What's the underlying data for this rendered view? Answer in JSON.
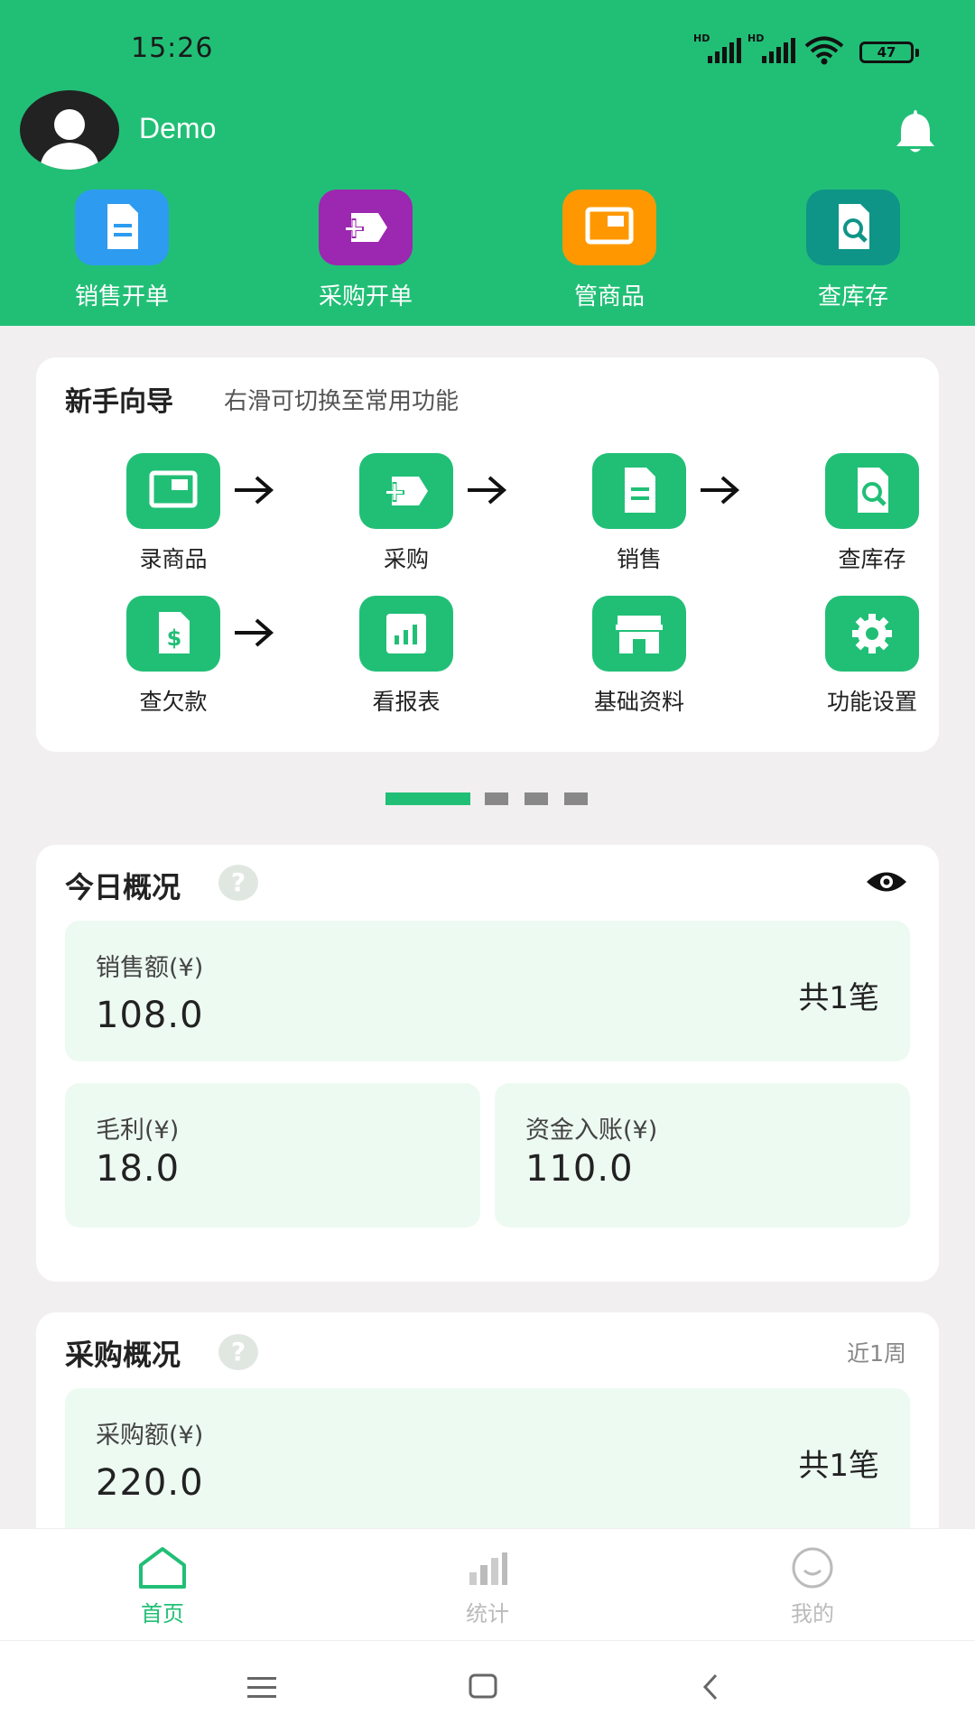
{
  "status": {
    "time": "15:26",
    "battery": "47",
    "sim1": "HD",
    "sim2": "HD"
  },
  "user": {
    "name": "Demo"
  },
  "quick_actions": [
    {
      "label": "销售开单",
      "icon": "document-icon",
      "color": "#2d9bf0"
    },
    {
      "label": "采购开单",
      "icon": "tag-plus-icon",
      "color": "#9c27b0"
    },
    {
      "label": "管商品",
      "icon": "product-card-icon",
      "color": "#ff9800"
    },
    {
      "label": "查库存",
      "icon": "search-document-icon",
      "color": "#0e9587"
    }
  ],
  "guide": {
    "title": "新手向导",
    "subtitle": "右滑可切换至常用功能",
    "items": [
      {
        "label": "录商品",
        "icon": "product-card-icon"
      },
      {
        "label": "采购",
        "icon": "tag-plus-icon"
      },
      {
        "label": "销售",
        "icon": "document-icon"
      },
      {
        "label": "查库存",
        "icon": "search-document-icon"
      },
      {
        "label": "查欠款",
        "icon": "dollar-document-icon"
      },
      {
        "label": "看报表",
        "icon": "bar-chart-icon"
      },
      {
        "label": "基础资料",
        "icon": "store-icon"
      },
      {
        "label": "功能设置",
        "icon": "gear-icon"
      }
    ]
  },
  "pager": {
    "pages": 4,
    "active": 1
  },
  "today": {
    "title": "今日概况",
    "sales_label": "销售额(¥)",
    "sales_value": "108.0",
    "sales_count": "共1笔",
    "profit_label": "毛利(¥)",
    "profit_value": "18.0",
    "income_label": "资金入账(¥)",
    "income_value": "110.0"
  },
  "purchase": {
    "title": "采购概况",
    "range": "近1周",
    "amount_label": "采购额(¥)",
    "amount_value": "220.0",
    "count": "共1笔"
  },
  "nav": [
    {
      "label": "首页",
      "active": true
    },
    {
      "label": "统计",
      "active": false
    },
    {
      "label": "我的",
      "active": false
    }
  ],
  "colors": {
    "primary": "#21bf76",
    "panel": "#edfaf2",
    "inactive": "#bbbbbb"
  }
}
